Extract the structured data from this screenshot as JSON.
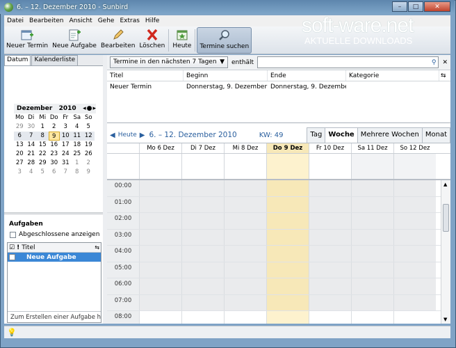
{
  "window": {
    "title": "6. – 12. Dezember 2010 - Sunbird",
    "min_label": "–",
    "max_label": "□",
    "close_label": "✕"
  },
  "watermark": {
    "title": "soft-ware.net",
    "subtitle": "AKTUELLE DOWNLOADS"
  },
  "menu": [
    "Datei",
    "Bearbeiten",
    "Ansicht",
    "Gehe",
    "Extras",
    "Hilfe"
  ],
  "toolbar": {
    "new_event": "Neuer Termin",
    "new_task": "Neue Aufgabe",
    "edit": "Bearbeiten",
    "delete": "Löschen",
    "today": "Heute",
    "find_events": "Termine suchen"
  },
  "left": {
    "tabs": [
      "Datum",
      "Kalenderliste"
    ],
    "minical": {
      "month": "Dezember",
      "year": "2010",
      "dow": [
        "Mo",
        "Di",
        "Mi",
        "Do",
        "Fr",
        "Sa",
        "So"
      ],
      "weeks": [
        [
          "29",
          "30",
          "1",
          "2",
          "3",
          "4",
          "5"
        ],
        [
          "6",
          "7",
          "8",
          "9",
          "10",
          "11",
          "12"
        ],
        [
          "13",
          "14",
          "15",
          "16",
          "17",
          "18",
          "19"
        ],
        [
          "20",
          "21",
          "22",
          "23",
          "24",
          "25",
          "26"
        ],
        [
          "27",
          "28",
          "29",
          "30",
          "31",
          "1",
          "2"
        ],
        [
          "3",
          "4",
          "5",
          "6",
          "7",
          "8",
          "9"
        ]
      ]
    },
    "tasks": {
      "title": "Aufgaben",
      "show_completed": "Abgeschlossene anzeigen",
      "col_title": "Titel",
      "items": [
        "Neue Aufgabe"
      ],
      "new_task_placeholder": "Zum Erstellen einer Aufgabe hi"
    }
  },
  "search": {
    "filter": "Termine in den nächsten 7 Tagen",
    "contains": "enthält",
    "columns": [
      "Titel",
      "Beginn",
      "Ende",
      "Kategorie"
    ],
    "rows": [
      [
        "Neuer Termin",
        "Donnerstag, 9. Dezember 2...",
        "Donnerstag, 9. Dezember...",
        ""
      ]
    ]
  },
  "calendar": {
    "today_label": "Heute",
    "range": "6. – 12. Dezember 2010",
    "week": "KW: 49",
    "views": [
      "Tag",
      "Woche",
      "Mehrere Wochen",
      "Monat"
    ],
    "days": [
      "Mo 6 Dez",
      "Di 7 Dez",
      "Mi 8 Dez",
      "Do 9 Dez",
      "Fr 10 Dez",
      "Sa 11 Dez",
      "So 12 Dez"
    ],
    "hours": [
      "00:00",
      "01:00",
      "02:00",
      "03:00",
      "04:00",
      "05:00",
      "06:00",
      "07:00",
      "08:00"
    ]
  }
}
